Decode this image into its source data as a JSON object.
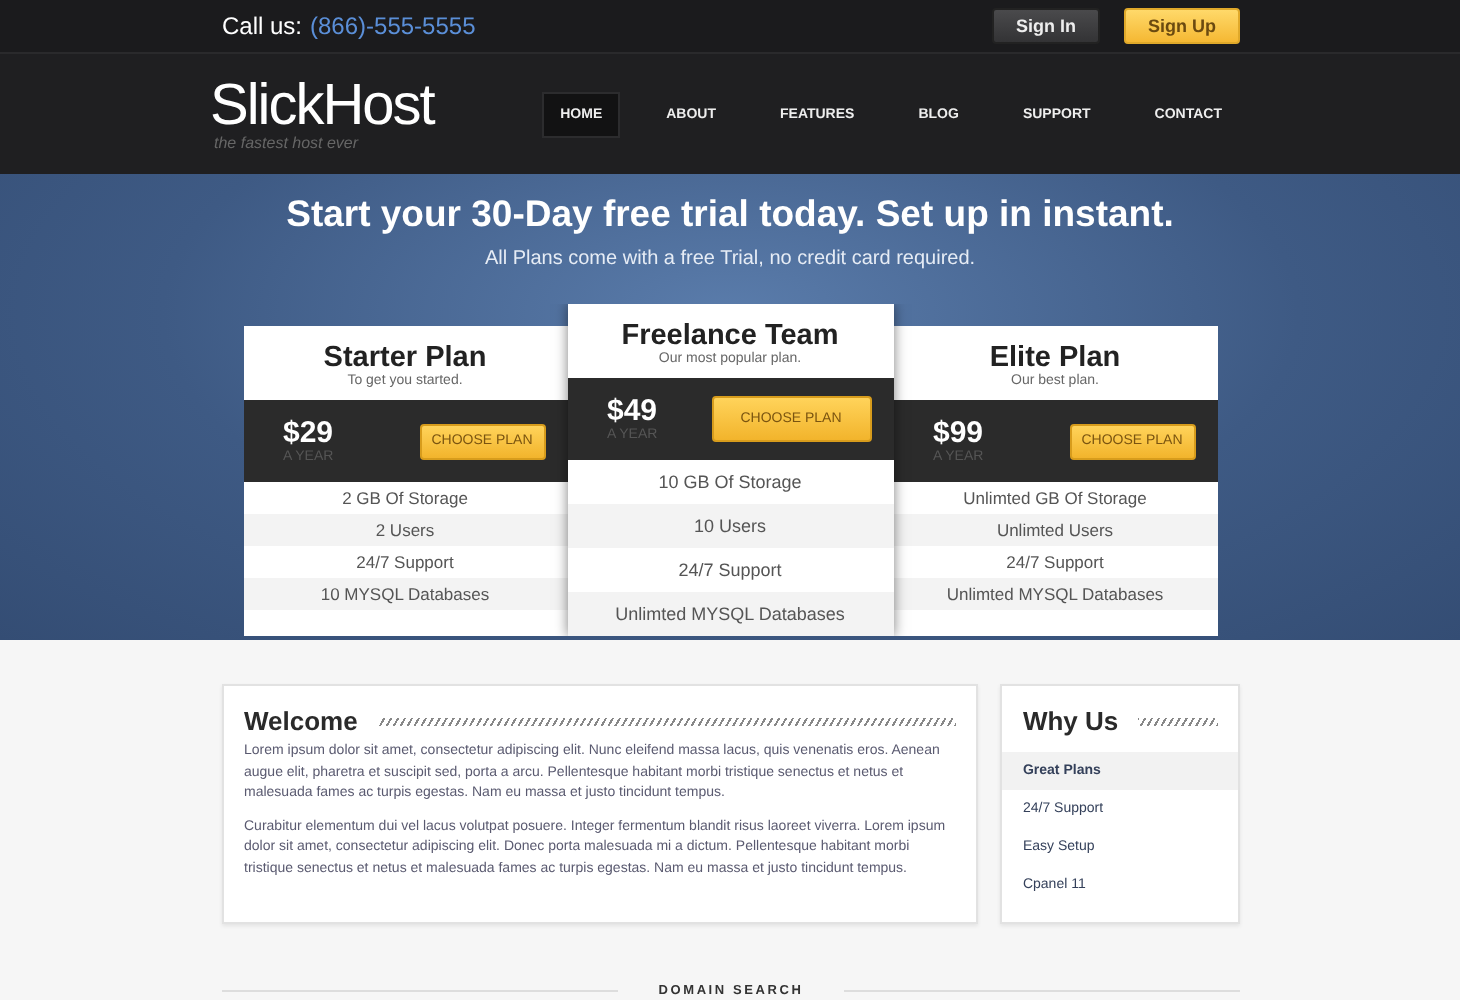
{
  "topbar": {
    "call_label": "Call us:",
    "phone": "(866)-555-5555",
    "buttons": [
      {
        "label": "Sign In",
        "kind": "dark"
      },
      {
        "label": "Sign Up",
        "kind": "yellow"
      }
    ]
  },
  "header": {
    "logo": "**Slick**Host",
    "tagline": "the fastest host ever",
    "nav": [
      {
        "label": "HOME",
        "selected": true
      },
      {
        "label": "ABOUT",
        "selected": false
      },
      {
        "label": "FEATURES",
        "selected": false
      },
      {
        "label": "BLOG",
        "selected": false
      },
      {
        "label": "SUPPORT",
        "selected": false
      },
      {
        "label": "CONTACT",
        "selected": false
      }
    ]
  },
  "hero": {
    "title": "Start your 30-Day free trial today. Set up in instant.",
    "subtitle": "All Plans come with a free Trial, no credit card required."
  },
  "plans": [
    {
      "name": "Starter Plan",
      "tagline": "To get you started.",
      "price": "$29",
      "period": "A YEAR",
      "button": "CHOOSE PLAN",
      "featured": false,
      "features": [
        "2 GB Of Storage",
        "2 Users",
        "24/7 Support",
        "10 MYSQL Databases"
      ]
    },
    {
      "name": "Freelance Team",
      "tagline": "Our most popular plan.",
      "price": "$49",
      "period": "A YEAR",
      "button": "CHOOSE PLAN",
      "featured": true,
      "features": [
        "10 GB Of Storage",
        "10 Users",
        "24/7 Support",
        "Unlimted MYSQL Databases"
      ]
    },
    {
      "name": "Elite Plan",
      "tagline": "Our best plan.",
      "price": "$99",
      "period": "A YEAR",
      "button": "CHOOSE PLAN",
      "featured": false,
      "features": [
        "Unlimted GB Of Storage",
        "Unlimted Users",
        "24/7 Support",
        "Unlimted MYSQL Databases"
      ]
    }
  ],
  "welcome": {
    "title": "Welcome",
    "paragraphs": [
      "Lorem ipsum dolor sit amet, consectetur adipiscing elit. Nunc eleifend massa lacus, quis venenatis eros. Aenean augue elit, pharetra et suscipit sed, porta a arcu. Pellentesque habitant morbi tristique senectus et netus et malesuada fames ac turpis egestas. Nam eu massa et justo tincidunt tempus.",
      "Curabitur elementum dui vel lacus volutpat posuere. Integer fermentum blandit risus laoreet viverra. Lorem ipsum dolor sit amet, consectetur adipiscing elit. Donec porta malesuada mi a dictum. Pellentesque habitant morbi tristique senectus et netus et malesuada fames ac turpis egestas. Nam eu massa et justo tincidunt tempus."
    ]
  },
  "why_us": {
    "title": "Why Us",
    "items": [
      {
        "label": "Great Plans",
        "selected": true
      },
      {
        "label": "24/7 Support",
        "selected": false
      },
      {
        "label": "Easy Setup",
        "selected": false
      },
      {
        "label": "Cpanel 11",
        "selected": false
      }
    ]
  },
  "domain_search": {
    "title": "DOMAIN SEARCH"
  }
}
